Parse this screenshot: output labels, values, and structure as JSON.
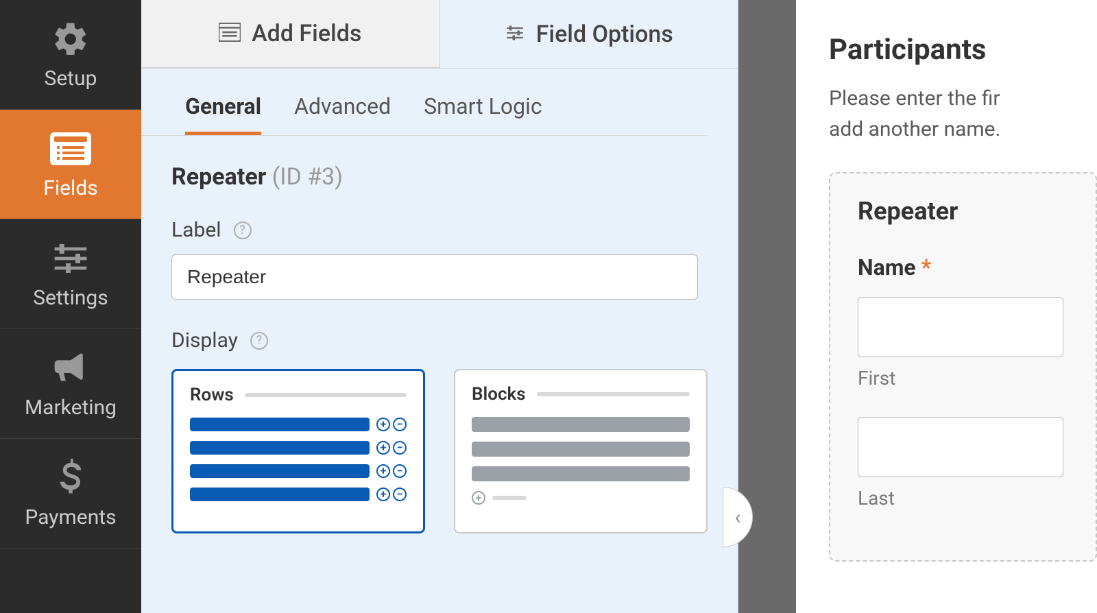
{
  "sidebar": {
    "items": [
      {
        "label": "Setup"
      },
      {
        "label": "Fields"
      },
      {
        "label": "Settings"
      },
      {
        "label": "Marketing"
      },
      {
        "label": "Payments"
      }
    ]
  },
  "main_tabs": {
    "add_fields": "Add Fields",
    "field_options": "Field Options"
  },
  "sub_tabs": {
    "general": "General",
    "advanced": "Advanced",
    "smart_logic": "Smart Logic"
  },
  "field": {
    "type": "Repeater",
    "id": "(ID #3)"
  },
  "form": {
    "label_label": "Label",
    "label_value": "Repeater",
    "display_label": "Display",
    "display_rows": "Rows",
    "display_blocks": "Blocks"
  },
  "preview": {
    "title": "Participants",
    "subtitle_line1": "Please enter the fir",
    "subtitle_line2": "add another name.",
    "repeater_label": "Repeater",
    "name_label": "Name",
    "required": "*",
    "first": "First",
    "last": "Last"
  }
}
